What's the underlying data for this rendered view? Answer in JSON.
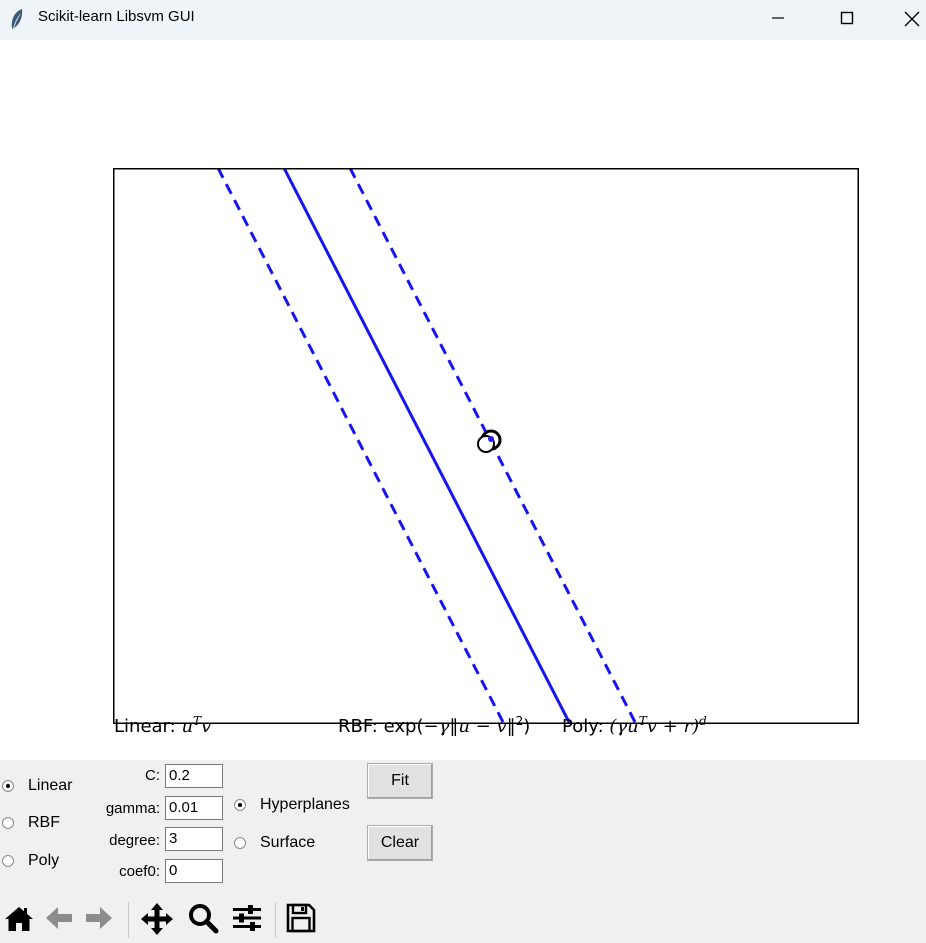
{
  "window": {
    "title": "Scikit-learn Libsvm GUI",
    "icon": "feather-icon",
    "buttons": [
      "minimize-icon",
      "maximize-icon",
      "close-icon"
    ]
  },
  "plot": {
    "margin_line_color": "#0000ff",
    "decision_line_color": "#0000ff",
    "point_colors": [
      "#000000",
      "#0000ff"
    ]
  },
  "formulas": {
    "linear_label": "Linear:",
    "rbf_label": "RBF:",
    "poly_label": "Poly:"
  },
  "kernel_options": {
    "items": [
      {
        "label": "Linear",
        "checked": true
      },
      {
        "label": "RBF",
        "checked": false
      },
      {
        "label": "Poly",
        "checked": false
      }
    ]
  },
  "params": {
    "c_label": "C:",
    "c_value": "0.2",
    "gamma_label": "gamma:",
    "gamma_value": "0.01",
    "degree_label": "degree:",
    "degree_value": "3",
    "coef0_label": "coef0:",
    "coef0_value": "0"
  },
  "display_options": {
    "items": [
      {
        "label": "Hyperplanes",
        "checked": true
      },
      {
        "label": "Surface",
        "checked": false
      }
    ]
  },
  "actions": {
    "fit_label": "Fit",
    "clear_label": "Clear"
  },
  "toolbar": {
    "icons": [
      "home-icon",
      "back-icon",
      "forward-icon",
      "pan-icon",
      "zoom-icon",
      "configure-icon",
      "save-icon"
    ]
  }
}
